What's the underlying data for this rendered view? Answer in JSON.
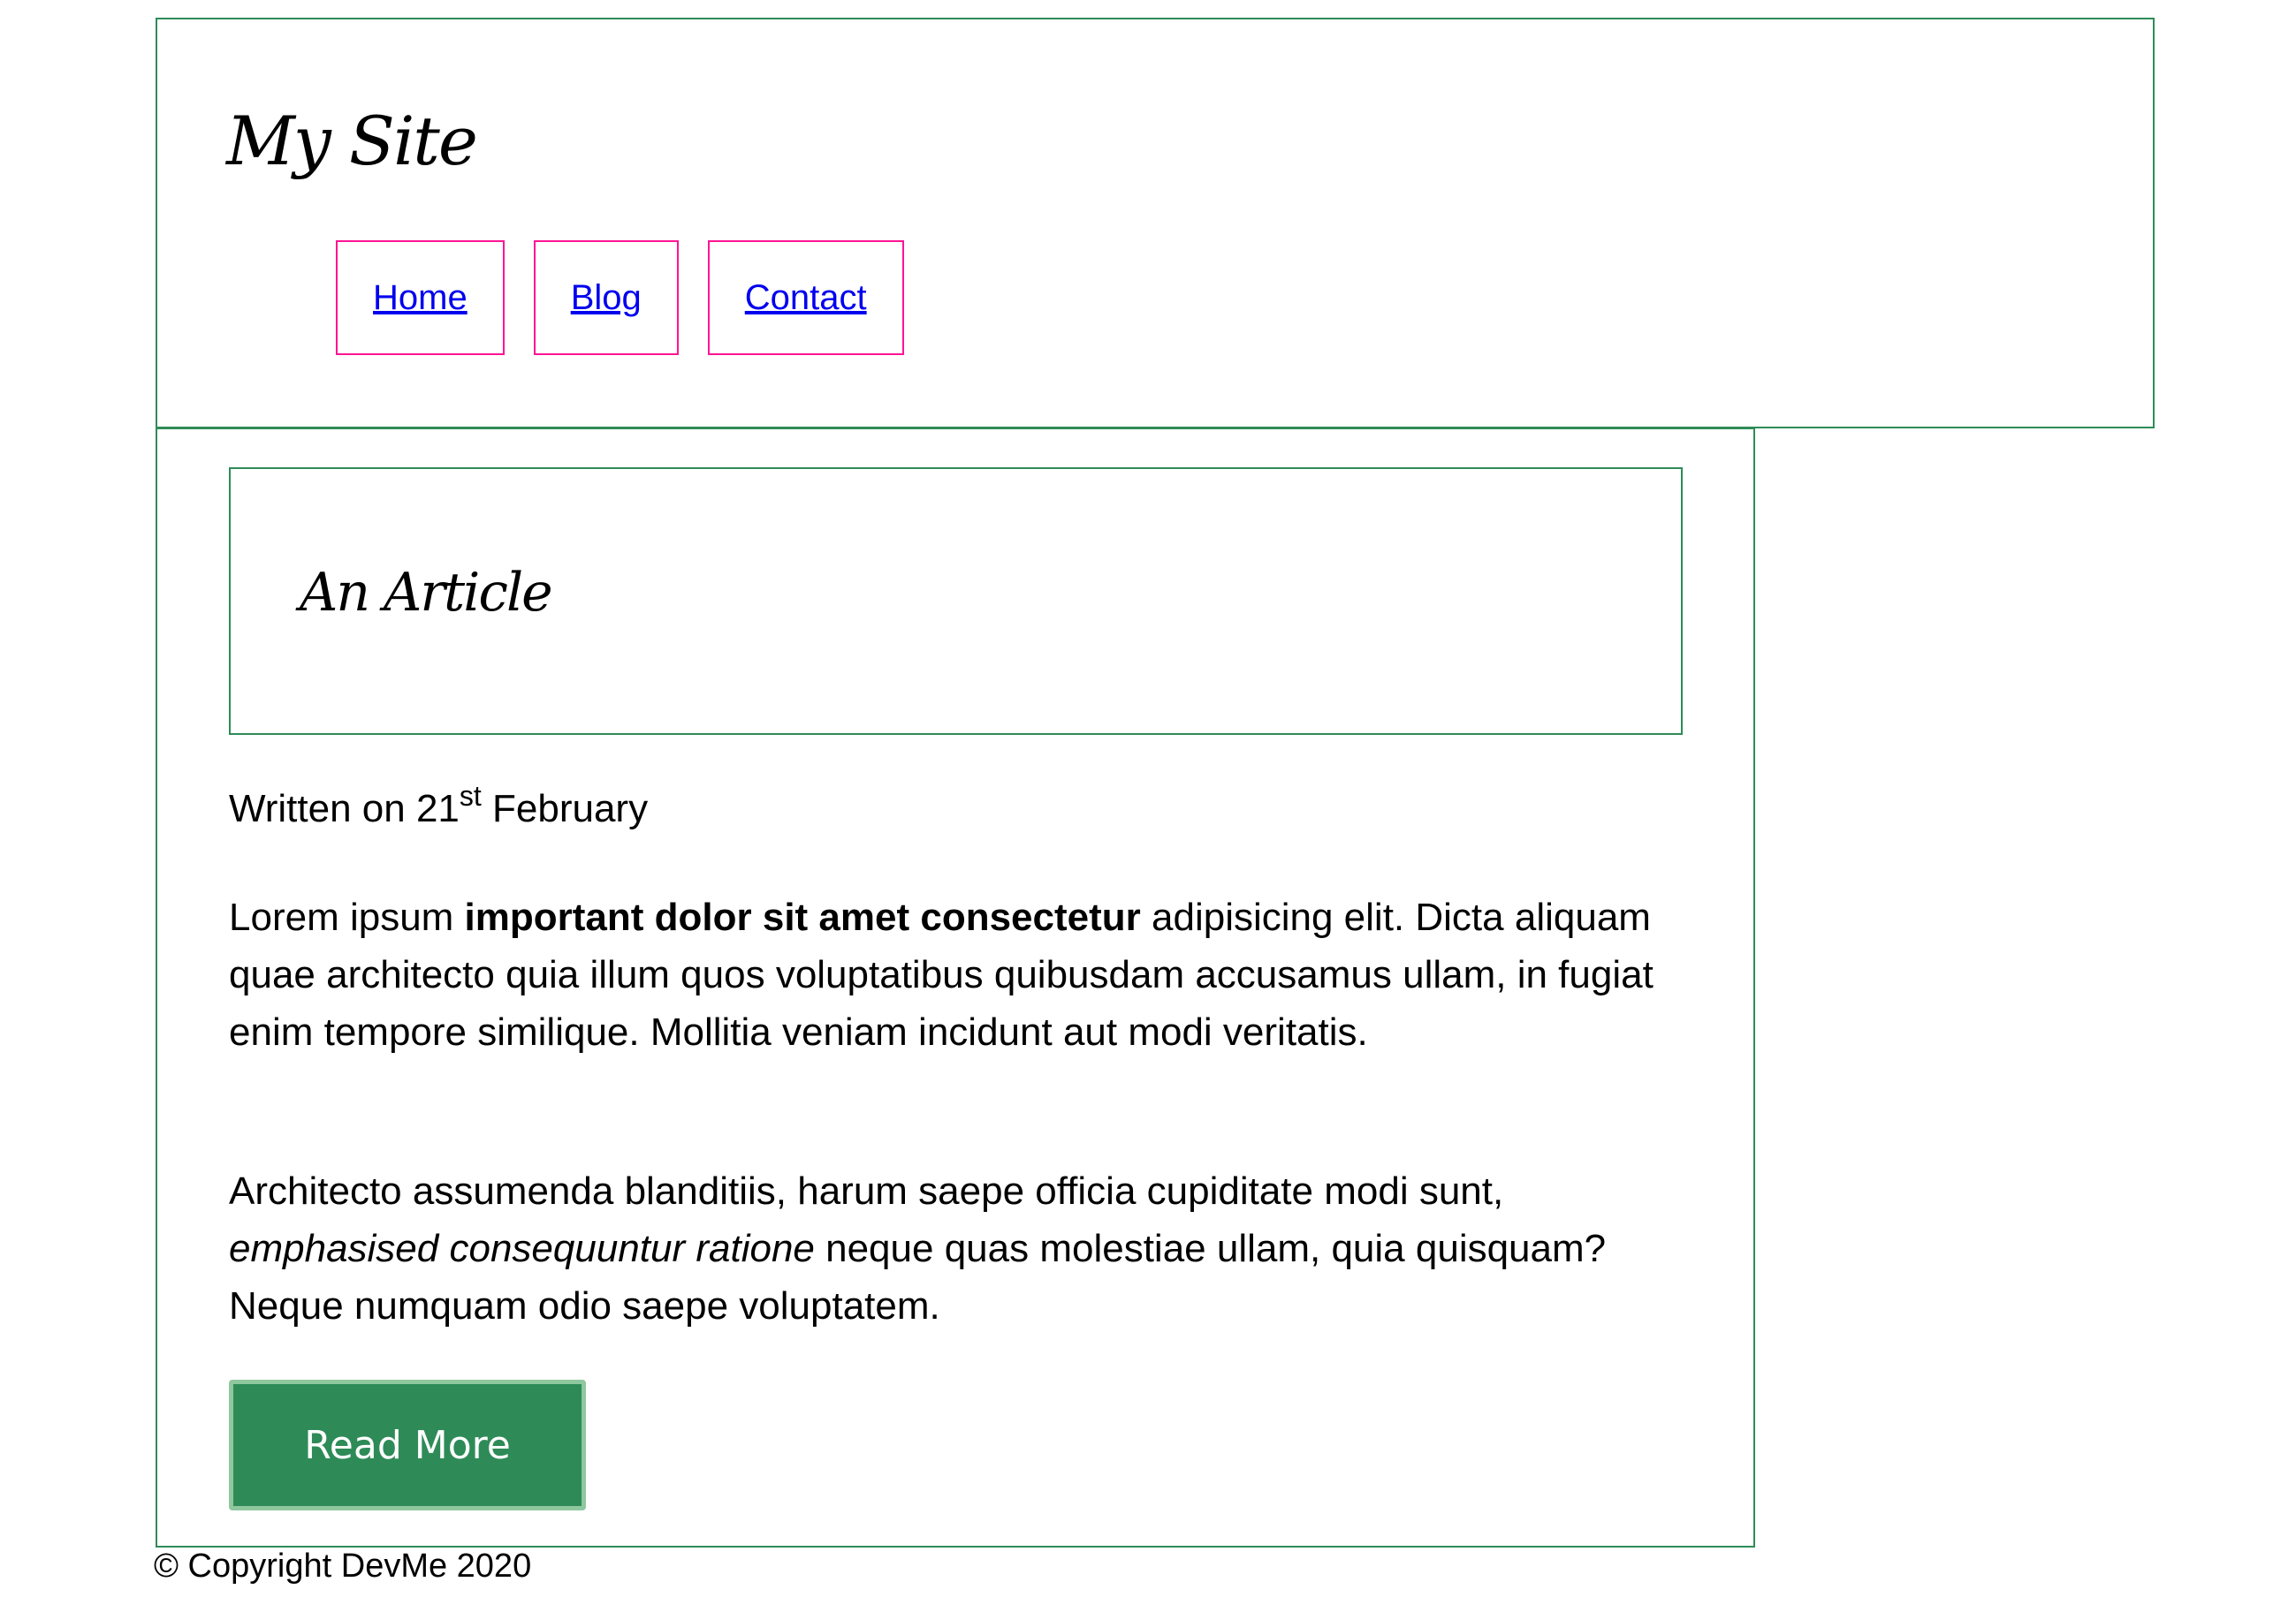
{
  "header": {
    "site_title": "My Site",
    "nav": [
      {
        "label": "Home"
      },
      {
        "label": "Blog"
      },
      {
        "label": "Contact"
      }
    ]
  },
  "article": {
    "title": "An Article",
    "meta": {
      "prefix": "Written on 21",
      "ordinal_suffix": "st",
      "month": " February"
    },
    "paragraph1": {
      "part1": "Lorem ipsum ",
      "bold": "important dolor sit amet consectetur",
      "part2": " adipisicing elit. Dicta aliquam quae architecto quia illum quos voluptatibus quibusdam accusamus ullam, in fugiat enim tempore similique. Mollitia veniam incidunt aut modi veritatis."
    },
    "paragraph2": {
      "part1": "Architecto assumenda blanditiis, harum saepe officia cupiditate modi sunt, ",
      "italic": "emphasised consequuntur ratione",
      "part2": " neque quas molestiae ullam, quia quisquam? Neque numquam odio saepe voluptatem."
    },
    "read_more_label": "Read More"
  },
  "footer": {
    "copyright": "© Copyright DevMe 2020"
  },
  "colors": {
    "border_green": "#2e8b57",
    "nav_border_pink": "#ff1493",
    "link_blue": "#0000ee",
    "button_green": "#2e8b57"
  }
}
